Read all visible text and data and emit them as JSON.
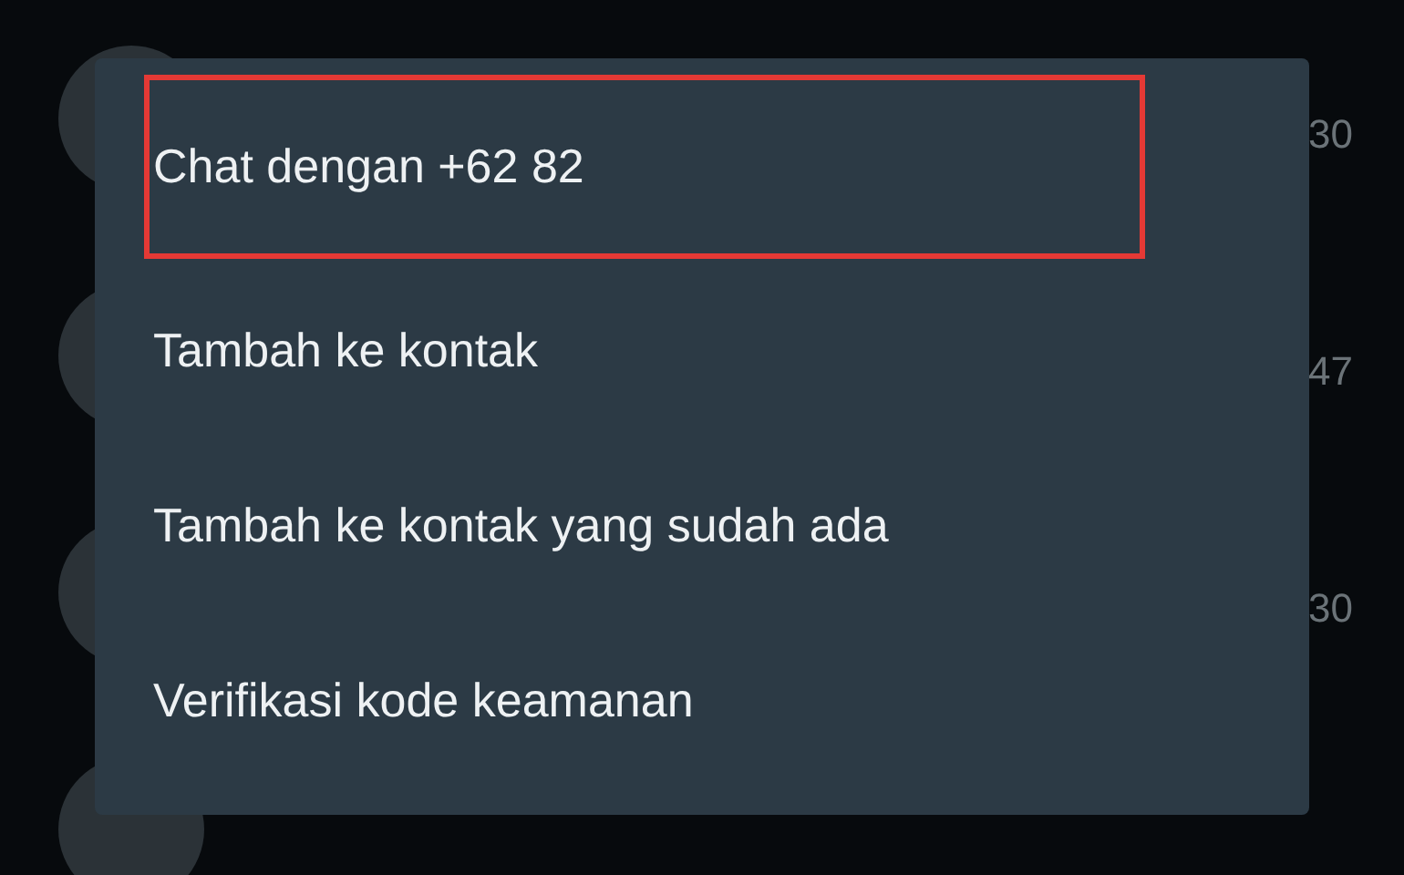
{
  "chat_list": [
    {
      "kind": "chat",
      "time": "30"
    },
    {
      "kind": "chat",
      "time": "47"
    },
    {
      "kind": "chat",
      "time": "30"
    },
    {
      "kind": "chat"
    }
  ],
  "context_menu": {
    "items": [
      {
        "label": "Chat dengan +62 82",
        "highlighted": true
      },
      {
        "label": "Tambah ke kontak",
        "highlighted": false
      },
      {
        "label": "Tambah ke kontak yang sudah ada",
        "highlighted": false
      },
      {
        "label": "Verifikasi kode keamanan",
        "highlighted": false
      }
    ]
  }
}
